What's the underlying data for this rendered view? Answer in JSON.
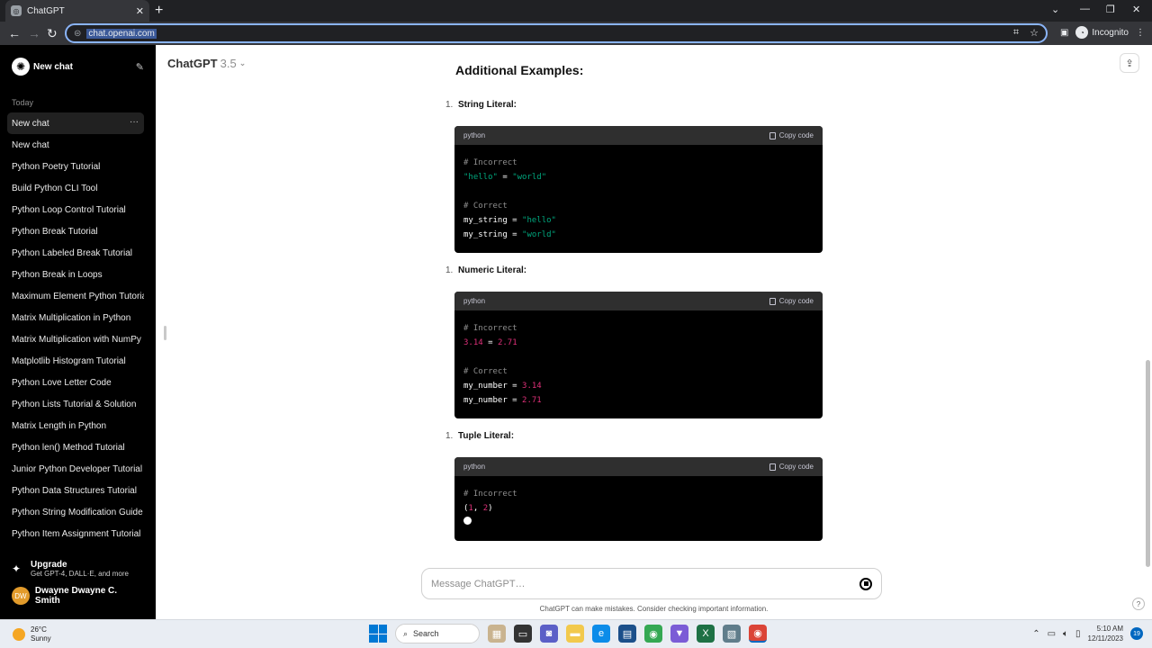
{
  "browser": {
    "tab_title": "ChatGPT",
    "url": "chat.openai.com",
    "incognito_label": "Incognito"
  },
  "sidebar": {
    "new_chat_label": "New chat",
    "section_label": "Today",
    "items": [
      {
        "label": "New chat"
      },
      {
        "label": "New chat"
      },
      {
        "label": "Python Poetry Tutorial"
      },
      {
        "label": "Build Python CLI Tool"
      },
      {
        "label": "Python Loop Control Tutorial"
      },
      {
        "label": "Python Break Tutorial"
      },
      {
        "label": "Python Labeled Break Tutorial"
      },
      {
        "label": "Python Break in Loops"
      },
      {
        "label": "Maximum Element Python Tutorial"
      },
      {
        "label": "Matrix Multiplication in Python"
      },
      {
        "label": "Matrix Multiplication with NumPy"
      },
      {
        "label": "Matplotlib Histogram Tutorial"
      },
      {
        "label": "Python Love Letter Code"
      },
      {
        "label": "Python Lists Tutorial & Solution"
      },
      {
        "label": "Matrix Length in Python"
      },
      {
        "label": "Python len() Method Tutorial"
      },
      {
        "label": "Junior Python Developer Tutorial"
      },
      {
        "label": "Python Data Structures Tutorial"
      },
      {
        "label": "Python String Modification Guide"
      },
      {
        "label": "Python Item Assignment Tutorial"
      }
    ],
    "upgrade_title": "Upgrade",
    "upgrade_sub": "Get GPT-4, DALL·E, and more",
    "user_initials": "DW",
    "user_name": "Dwayne Dwayne C. Smith"
  },
  "header": {
    "model_name": "ChatGPT",
    "model_version": "3.5"
  },
  "content": {
    "heading": "Additional Examples:",
    "sections": [
      {
        "num": "1.",
        "label": "String Literal:",
        "lang": "python",
        "copy": "Copy code"
      },
      {
        "num": "1.",
        "label": "Numeric Literal:",
        "lang": "python",
        "copy": "Copy code"
      },
      {
        "num": "1.",
        "label": "Tuple Literal:",
        "lang": "python",
        "copy": "Copy code"
      }
    ],
    "code": {
      "s1_l1": "# Incorrect",
      "s1_l2a": "\"hello\"",
      "s1_l2b": " = ",
      "s1_l2c": "\"world\"",
      "s1_l3": "# Correct",
      "s1_l4a": "my_string = ",
      "s1_l4b": "\"hello\"",
      "s1_l5a": "my_string = ",
      "s1_l5b": "\"world\"",
      "s2_l1": "# Incorrect",
      "s2_l2a": "3.14",
      "s2_l2b": " = ",
      "s2_l2c": "2.71",
      "s2_l3": "# Correct",
      "s2_l4a": "my_number = ",
      "s2_l4b": "3.14",
      "s2_l5a": "my_number = ",
      "s2_l5b": "2.71",
      "s3_l1": "# Incorrect",
      "s3_l2a": "(",
      "s3_l2b": "1",
      "s3_l2c": ", ",
      "s3_l2d": "2",
      "s3_l2e": ")"
    }
  },
  "composer": {
    "placeholder": "Message ChatGPT…",
    "disclaimer": "ChatGPT can make mistakes. Consider checking important information.",
    "help": "?"
  },
  "taskbar": {
    "temp": "26°C",
    "weather": "Sunny",
    "search_label": "Search",
    "time": "5:10 AM",
    "date": "12/11/2023",
    "notif_count": "19"
  }
}
